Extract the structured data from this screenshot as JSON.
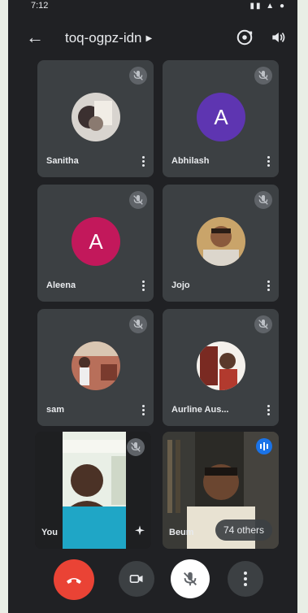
{
  "status_bar": {
    "time": "7:12"
  },
  "meeting": {
    "code": "toq-ogpz-idn"
  },
  "participants": [
    {
      "name": "Sanitha",
      "type": "photo"
    },
    {
      "name": "Abhilash",
      "type": "initial",
      "initial": "A",
      "color": "#5e35b1"
    },
    {
      "name": "Aleena",
      "type": "initial",
      "initial": "A",
      "color": "#c2185b"
    },
    {
      "name": "Jojo",
      "type": "photo"
    },
    {
      "name": "sam",
      "type": "photo"
    },
    {
      "name": "Aurline Aus...",
      "type": "photo"
    }
  ],
  "self_tile": {
    "label": "You"
  },
  "remote_tile": {
    "label": "Beum",
    "others": "74 others"
  },
  "colors": {
    "background": "#202124",
    "tile": "#3c4043",
    "end_call": "#ea4335",
    "accent": "#1a73e8"
  }
}
